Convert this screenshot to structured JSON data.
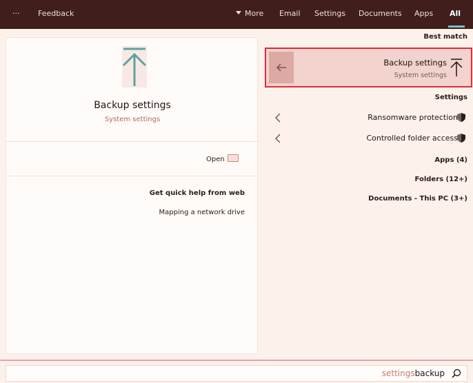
{
  "nav": {
    "feedback": "Feedback",
    "more_menu": "···",
    "tabs": [
      "All",
      "Apps",
      "Documents",
      "Settings",
      "Email",
      "More"
    ]
  },
  "preview": {
    "title": "Backup settings",
    "subtitle": "System settings",
    "open_label": "Open",
    "web_heading": "Get quick help from web",
    "web_link": "Mapping a network drive"
  },
  "results": {
    "best_match_label": "Best match",
    "best_match": {
      "title": "Backup settings",
      "subtitle": "System settings"
    },
    "settings_label": "Settings",
    "settings_items": [
      "Ransomware protection",
      "Controlled folder access"
    ],
    "groups": [
      "Apps (4)",
      "Folders (12+)",
      "Documents - This PC (3+)"
    ]
  },
  "search": {
    "typed": "backup",
    "suggestion": " settings"
  },
  "colors": {
    "topbar": "#3f1e1b",
    "accent_underline": "#7fc0bb",
    "highlight_border": "#e22a35",
    "selection_bg": "#f2d3cd",
    "search_border": "#e6a3a9"
  }
}
